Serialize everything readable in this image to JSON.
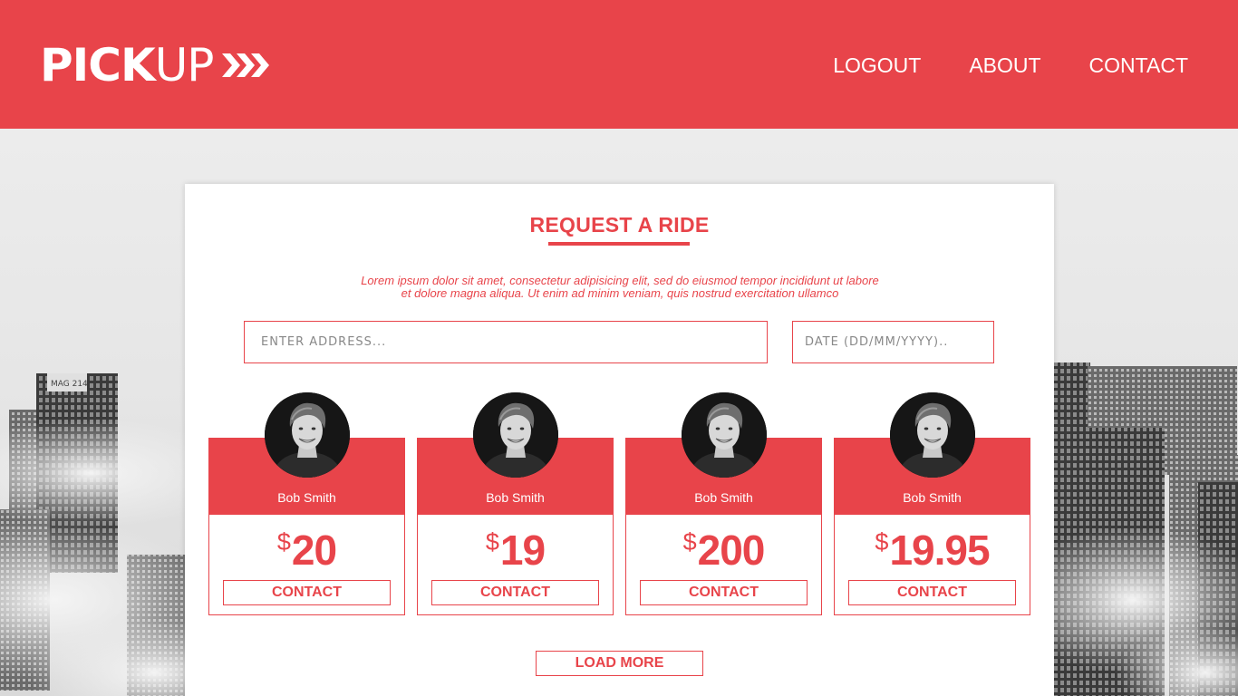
{
  "brand": {
    "name_bold": "PICK",
    "name_light": "UP",
    "logo_icon": "chevrons-right-icon",
    "accent_color": "#e8444a"
  },
  "nav": {
    "items": [
      {
        "label": "LOGOUT"
      },
      {
        "label": "ABOUT"
      },
      {
        "label": "CONTACT"
      }
    ]
  },
  "background": {
    "building_sign": "MAG 214"
  },
  "request": {
    "title": "REQUEST A RIDE",
    "description": "Lorem ipsum dolor sit amet, consectetur adipisicing elit, sed do eiusmod tempor incididunt ut labore et dolore magna aliqua. Ut enim ad minim veniam, quis nostrud exercitation ullamco",
    "address_placeholder": "ENTER ADDRESS...",
    "date_placeholder": "DATE (DD/MM/YYYY).."
  },
  "drivers": [
    {
      "name": "Bob Smith",
      "currency": "$",
      "price": "20",
      "button": "CONTACT"
    },
    {
      "name": "Bob Smith",
      "currency": "$",
      "price": "19",
      "button": "CONTACT"
    },
    {
      "name": "Bob Smith",
      "currency": "$",
      "price": "200",
      "button": "CONTACT"
    },
    {
      "name": "Bob Smith",
      "currency": "$",
      "price": "19.95",
      "button": "CONTACT"
    }
  ],
  "load_more_label": "LOAD MORE"
}
